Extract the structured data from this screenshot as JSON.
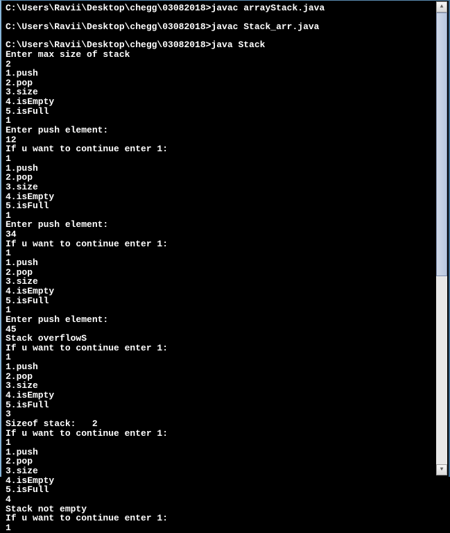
{
  "terminal": {
    "lines": [
      "C:\\Users\\Ravii\\Desktop\\chegg\\03082018>javac arrayStack.java",
      "",
      "C:\\Users\\Ravii\\Desktop\\chegg\\03082018>javac Stack_arr.java",
      "",
      "C:\\Users\\Ravii\\Desktop\\chegg\\03082018>java Stack",
      "Enter max size of stack",
      "2",
      "1.push",
      "2.pop",
      "3.size",
      "4.isEmpty",
      "5.isFull",
      "1",
      "Enter push element:",
      "12",
      "If u want to continue enter 1:",
      "1",
      "1.push",
      "2.pop",
      "3.size",
      "4.isEmpty",
      "5.isFull",
      "1",
      "Enter push element:",
      "34",
      "If u want to continue enter 1:",
      "1",
      "1.push",
      "2.pop",
      "3.size",
      "4.isEmpty",
      "5.isFull",
      "1",
      "Enter push element:",
      "45",
      "Stack overflowS",
      "If u want to continue enter 1:",
      "1",
      "1.push",
      "2.pop",
      "3.size",
      "4.isEmpty",
      "5.isFull",
      "3",
      "Sizeof stack:   2",
      "If u want to continue enter 1:",
      "1",
      "1.push",
      "2.pop",
      "3.size",
      "4.isEmpty",
      "5.isFull",
      "4",
      "Stack not empty",
      "If u want to continue enter 1:",
      "1"
    ]
  },
  "scrollbar": {
    "up_glyph": "▲",
    "down_glyph": "▼"
  }
}
